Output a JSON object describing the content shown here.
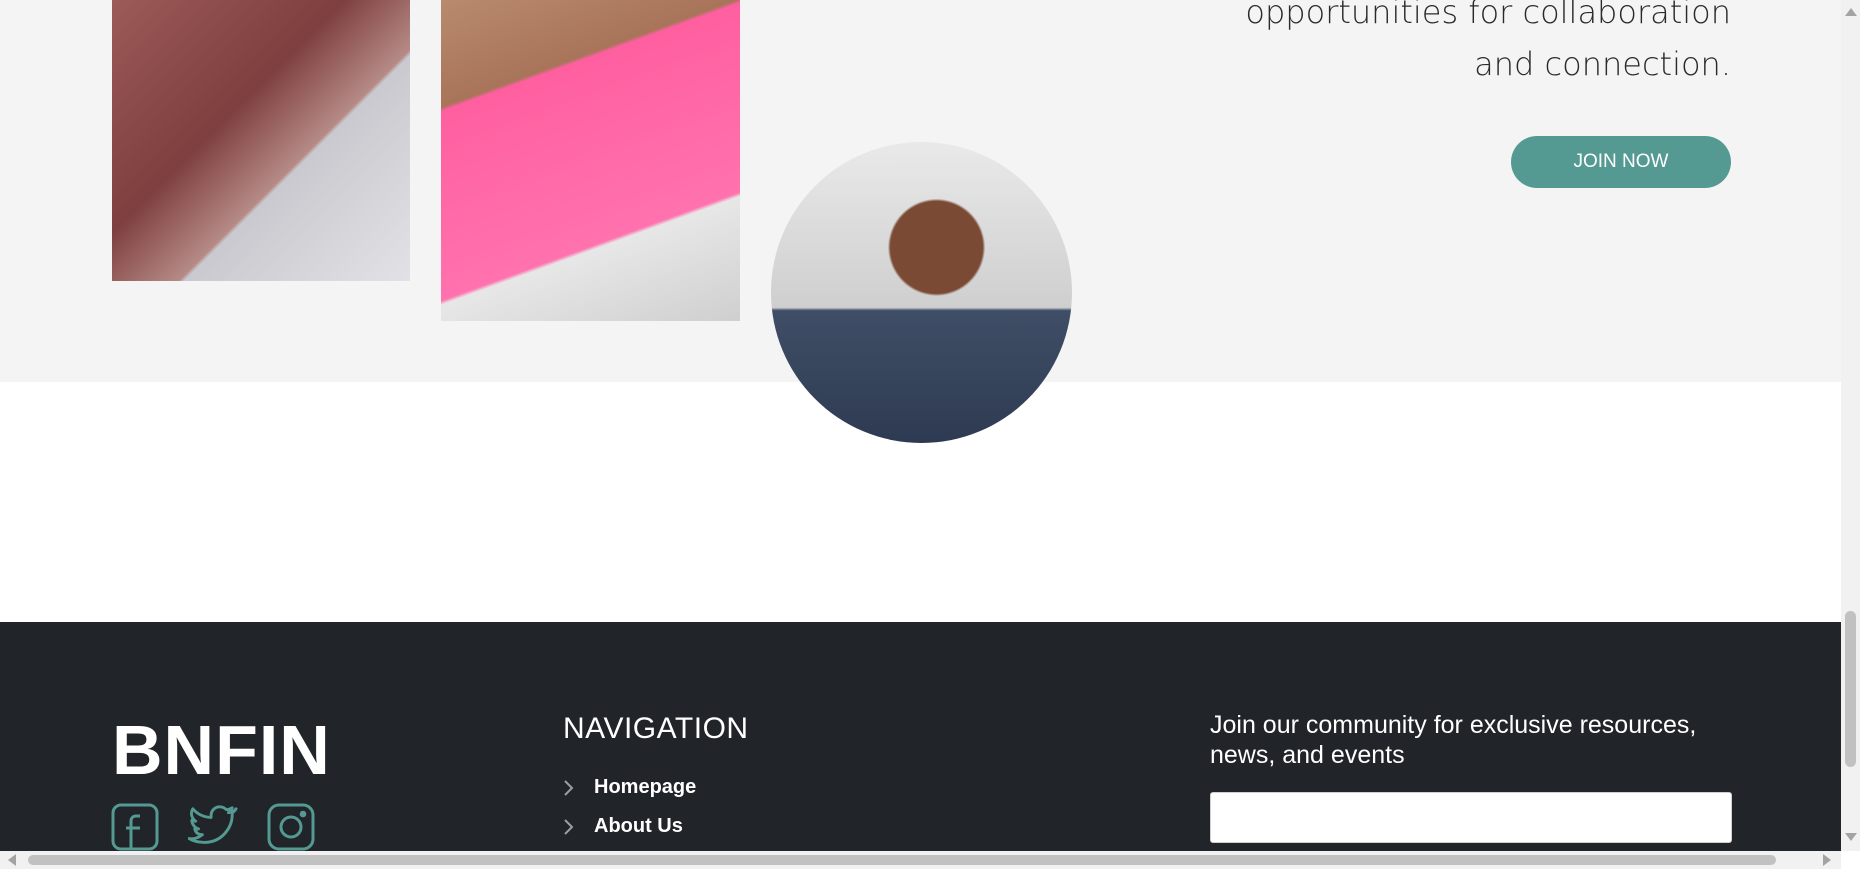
{
  "hero": {
    "text_line_1": "opportunities for collaboration",
    "text_line_2": "and connection.",
    "join_label": "JOIN NOW",
    "accent_color": "#559a92"
  },
  "footer": {
    "brand": "BNFIN",
    "social_icons": [
      "facebook-icon",
      "twitter-icon",
      "instagram-icon"
    ],
    "nav_title": "NAVIGATION",
    "nav_items": [
      {
        "label": "Homepage"
      },
      {
        "label": "About Us"
      }
    ],
    "community_text": "Join our community for exclusive resources, news, and events",
    "email_placeholder": "",
    "bg_color": "#212429"
  }
}
